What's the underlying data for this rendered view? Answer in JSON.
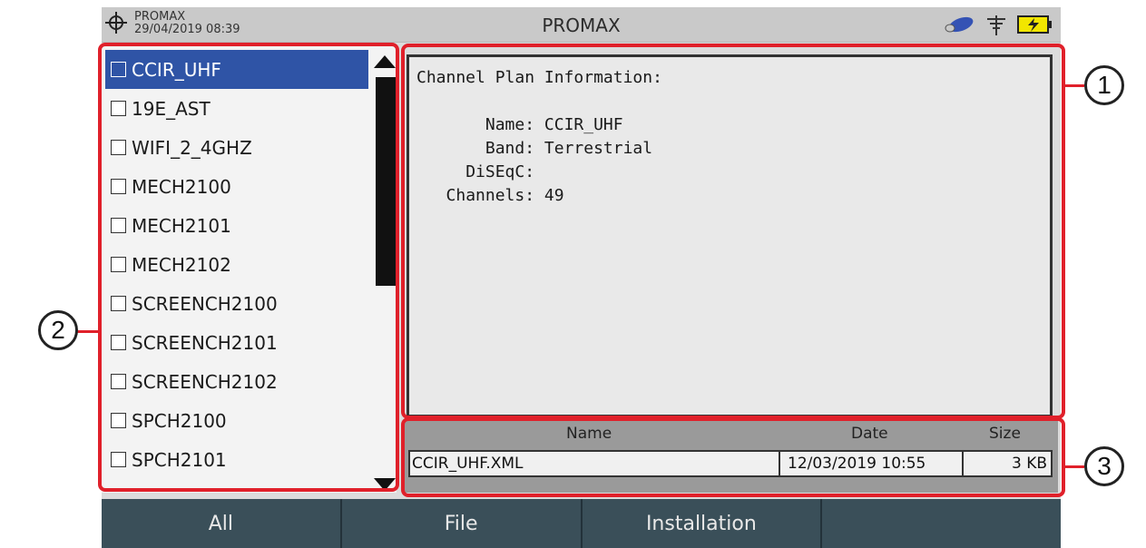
{
  "header": {
    "brand": "PROMAX",
    "datetime": "29/04/2019 08:39",
    "title": "PROMAX",
    "icons": [
      "crosshair-icon",
      "usb-drive-icon",
      "antenna-icon",
      "battery-charging-icon"
    ]
  },
  "channel_list": {
    "selected": "CCIR_UHF",
    "items": [
      {
        "label": "CCIR_UHF"
      },
      {
        "label": "19E_AST"
      },
      {
        "label": "WIFI_2_4GHZ"
      },
      {
        "label": "MECH2100"
      },
      {
        "label": "MECH2101"
      },
      {
        "label": "MECH2102"
      },
      {
        "label": "SCREENCH2100"
      },
      {
        "label": "SCREENCH2101"
      },
      {
        "label": "SCREENCH2102"
      },
      {
        "label": "SPCH2100"
      },
      {
        "label": "SPCH2101"
      }
    ]
  },
  "info": {
    "heading": "Channel Plan Information:",
    "name_label": "Name:",
    "name_value": "CCIR_UHF",
    "band_label": "Band:",
    "band_value": "Terrestrial",
    "diseqc_label": "DiSEqC:",
    "diseqc_value": "",
    "channels_label": "Channels:",
    "channels_value": "49"
  },
  "file_table": {
    "headers": {
      "name": "Name",
      "date": "Date",
      "size": "Size"
    },
    "row": {
      "name": "CCIR_UHF.XML",
      "date": "12/03/2019 10:55",
      "size": "3 KB"
    }
  },
  "bottom_buttons": [
    "All",
    "File",
    "Installation",
    ""
  ],
  "callouts": [
    "1",
    "2",
    "3"
  ],
  "colors": {
    "callout_red": "#e0202a",
    "selection_blue": "#2f54a6",
    "button_bar": "#3a4f59"
  }
}
